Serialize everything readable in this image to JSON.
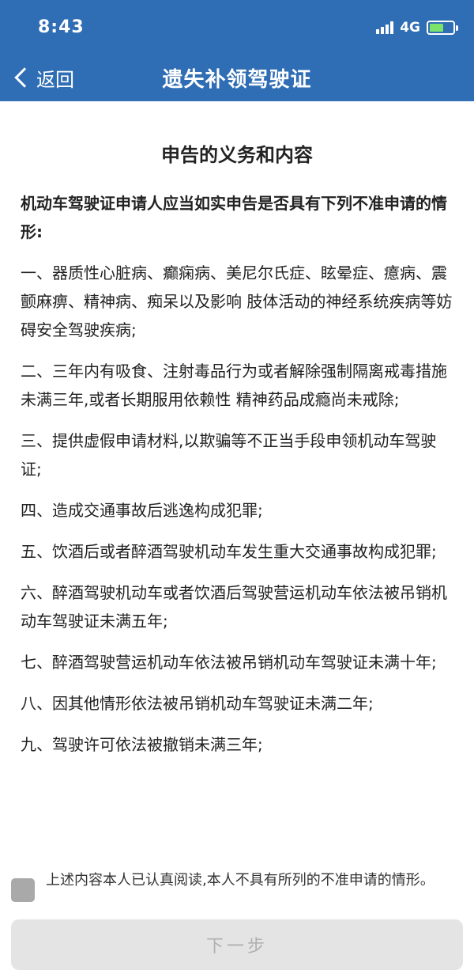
{
  "status": {
    "time": "8:43",
    "network": "4G"
  },
  "nav": {
    "back_label": "返回",
    "title": "遗失补领驾驶证"
  },
  "section_title": "申告的义务和内容",
  "intro": "机动车驾驶证申请人应当如实申告是否具有下列不准申请的情形:",
  "items": [
    "一、器质性心脏病、癫痫病、美尼尔氏症、眩晕症、癔病、震颤麻痹、精神病、痴呆以及影响 肢体活动的神经系统疾病等妨碍安全驾驶疾病;",
    "二、三年内有吸食、注射毒品行为或者解除强制隔离戒毒措施未满三年,或者长期服用依赖性 精神药品成瘾尚未戒除;",
    "三、提供虚假申请材料,以欺骗等不正当手段申领机动车驾驶证;",
    "四、造成交通事故后逃逸构成犯罪;",
    "五、饮酒后或者醉酒驾驶机动车发生重大交通事故构成犯罪;",
    "六、醉酒驾驶机动车或者饮酒后驾驶营运机动车依法被吊销机动车驾驶证未满五年;",
    "七、醉酒驾驶营运机动车依法被吊销机动车驾驶证未满十年;",
    "八、因其他情形依法被吊销机动车驾驶证未满二年;",
    "九、驾驶许可依法被撤销未满三年;"
  ],
  "agreement": {
    "text": "上述内容本人已认真阅读,本人不具有所列的不准申请的情形。",
    "checked": false
  },
  "next_button": {
    "label": "下一步",
    "enabled": false
  },
  "colors": {
    "header": "#2f6db4",
    "checkbox": "#a9a9a9",
    "button_disabled": "#e4e4e4"
  }
}
